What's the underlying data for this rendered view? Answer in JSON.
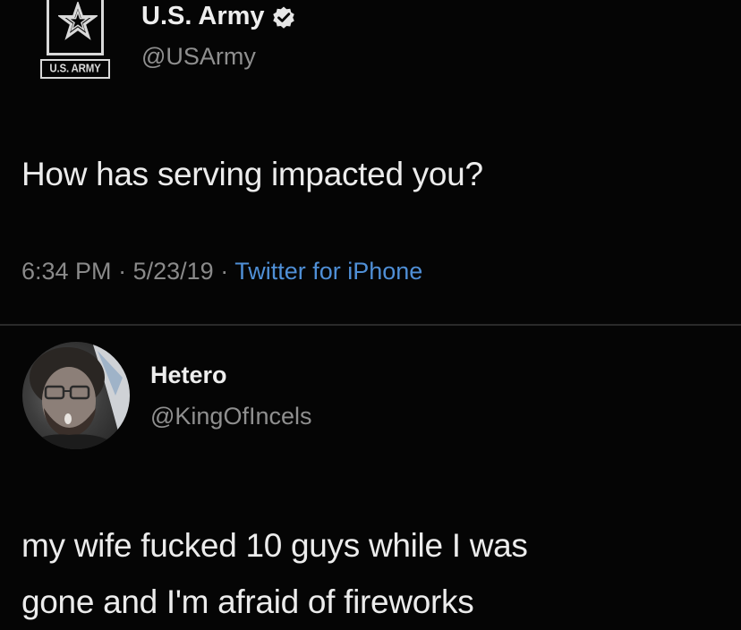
{
  "tweet": {
    "display_name": "U.S. Army",
    "handle": "@USArmy",
    "verified": true,
    "logo_text": "U.S. ARMY",
    "text": "How has serving impacted you?",
    "time": "6:34 PM",
    "date": "5/23/19",
    "separator": "·",
    "source": "Twitter for iPhone"
  },
  "reply": {
    "display_name": "Hetero",
    "handle": "@KingOfIncels",
    "text_line1": "my wife fucked 10 guys while I was",
    "text_line2": "gone and I'm afraid of fireworks"
  },
  "colors": {
    "background": "#050505",
    "text": "#ececec",
    "secondary": "#8a8a8a",
    "link": "#4f8fd6"
  },
  "icons": {
    "verified": "verified-check-icon",
    "logo": "army-star-logo"
  }
}
